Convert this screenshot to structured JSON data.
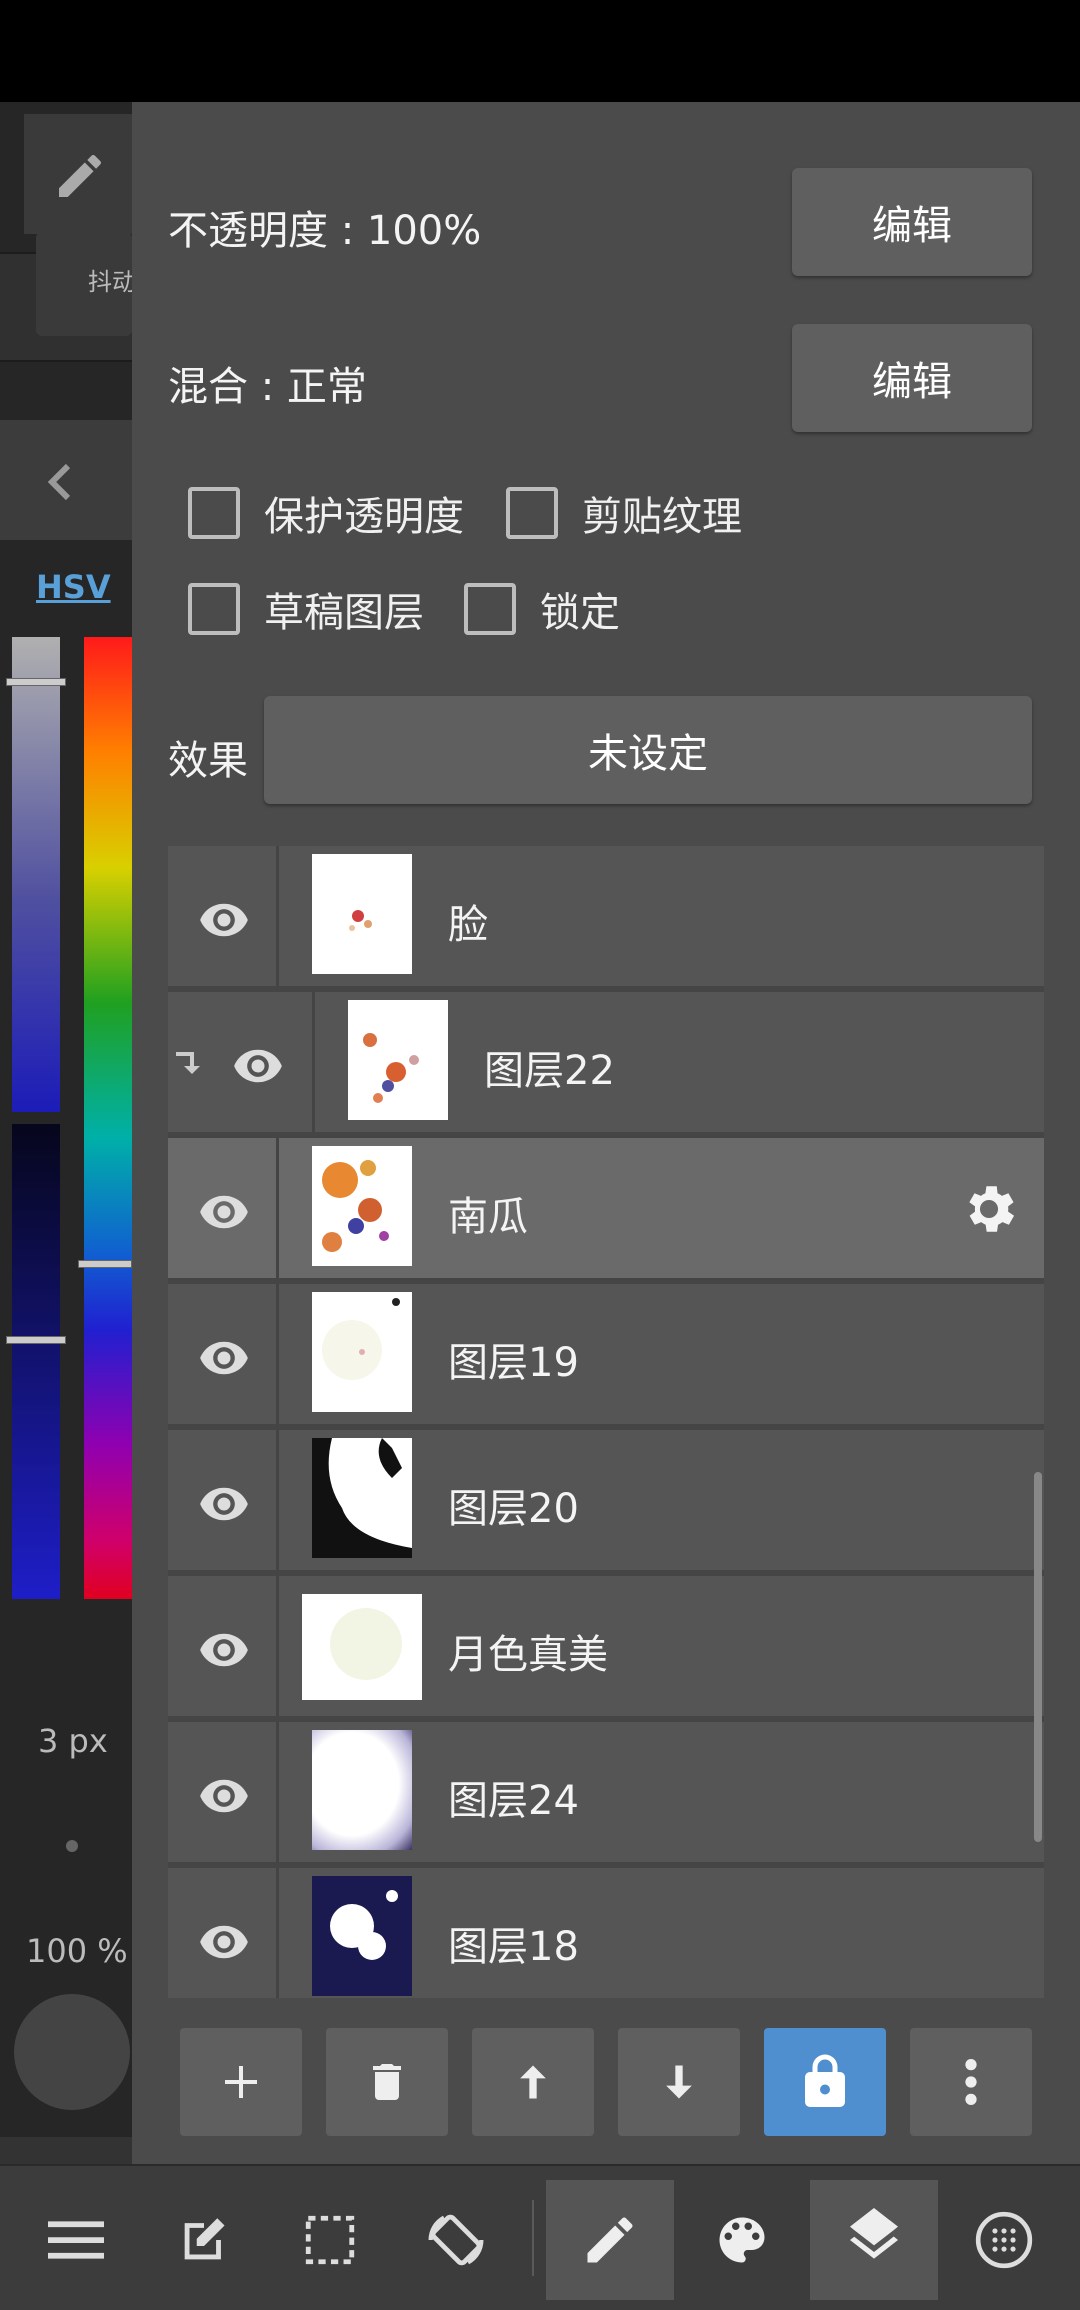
{
  "left_strip": {
    "brush_chip_text": "抖动",
    "color_mode_tab": "HSV",
    "brush_size": "3 px",
    "opacity": "100 %"
  },
  "layer_properties": {
    "opacity_label": "不透明度 : 100%",
    "opacity_edit": "编辑",
    "blend_label": "混合 : 正常",
    "blend_edit": "编辑",
    "checkboxes": [
      {
        "label": "保护透明度",
        "checked": false
      },
      {
        "label": "剪贴纹理",
        "checked": false
      },
      {
        "label": "草稿图层",
        "checked": false
      },
      {
        "label": "锁定",
        "checked": false
      }
    ],
    "effect_label": "效果",
    "effect_value": "未设定"
  },
  "layers": [
    {
      "name": "脸",
      "visible": true,
      "clipped": false,
      "selected": false
    },
    {
      "name": "图层22",
      "visible": true,
      "clipped": true,
      "selected": false
    },
    {
      "name": "南瓜",
      "visible": true,
      "clipped": false,
      "selected": true
    },
    {
      "name": "图层19",
      "visible": true,
      "clipped": false,
      "selected": false
    },
    {
      "name": "图层20",
      "visible": true,
      "clipped": false,
      "selected": false
    },
    {
      "name": "月色真美",
      "visible": true,
      "clipped": false,
      "selected": false
    },
    {
      "name": "图层24",
      "visible": true,
      "clipped": false,
      "selected": false
    },
    {
      "name": "图层18",
      "visible": true,
      "clipped": false,
      "selected": false
    }
  ],
  "layer_toolbar": {
    "icons": [
      "add-icon",
      "trash-icon",
      "arrow-up-icon",
      "arrow-down-icon",
      "lock-icon",
      "more-vertical-icon"
    ],
    "active_color": "#4f8fcf"
  },
  "bottom_nav": {
    "icons": [
      "menu-icon",
      "edit-square-icon",
      "selection-icon",
      "rotate-icon",
      "pen-icon",
      "palette-icon",
      "layers-icon",
      "grid-dots-icon"
    ],
    "active": [
      "pen-icon",
      "layers-icon"
    ]
  }
}
